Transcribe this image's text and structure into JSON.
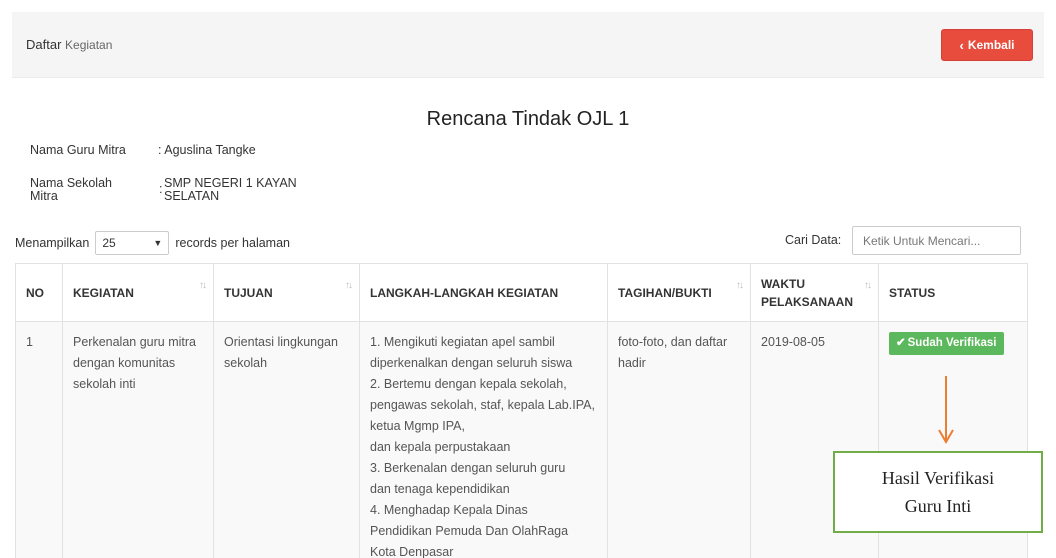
{
  "header": {
    "title": "Daftar",
    "subtitle": "Kegiatan",
    "back_label": "Kembali"
  },
  "page_heading": "Rencana Tindak OJL 1",
  "info": {
    "guru_label": "Nama Guru Mitra",
    "guru_value": ": Aguslina Tangke",
    "sekolah_label_1": "Nama Sekolah",
    "sekolah_label_2": "Mitra",
    "sekolah_value_1": "SMP NEGERI 1 KAYAN",
    "sekolah_value_2": "SELATAN",
    "sekolah_colon": ":"
  },
  "table_controls": {
    "show_label": "Menampilkan",
    "page_size": "25",
    "per_page_label": "records per halaman",
    "search_label": "Cari Data:",
    "search_placeholder": "Ketik Untuk Mencari..."
  },
  "table": {
    "columns": [
      "NO",
      "KEGIATAN",
      "TUJUAN",
      "LANGKAH-LANGKAH KEGIATAN",
      "TAGIHAN/BUKTI",
      "WAKTU PELAKSANAAN",
      "STATUS"
    ],
    "rows": [
      {
        "no": "1",
        "kegiatan": "Perkenalan guru mitra dengan komunitas sekolah inti",
        "tujuan": "Orientasi lingkungan sekolah",
        "langkah": [
          "1. Mengikuti kegiatan apel sambil",
          "diperkenalkan dengan seluruh siswa",
          "2. Bertemu dengan kepala sekolah,",
          "pengawas sekolah, staf, kepala Lab.IPA,",
          "ketua Mgmp IPA,",
          "dan kepala perpustakaan",
          "3. Berkenalan dengan seluruh guru",
          "dan tenaga kependidikan",
          "4. Menghadap Kepala Dinas",
          "Pendidikan Pemuda Dan OlahRaga",
          "Kota Denpasar"
        ],
        "tagihan": "foto-foto, dan daftar hadir",
        "waktu": "2019-08-05",
        "status": "Sudah Verifikasi"
      }
    ]
  },
  "callout": {
    "line1": "Hasil Verifikasi",
    "line2": "Guru Inti"
  },
  "colors": {
    "danger": "#e74c3c",
    "success": "#5cb85c",
    "arrow": "#ed7d31",
    "callout_border": "#70ad47"
  },
  "icons": {
    "back": "chevron-left-icon",
    "status": "check-icon",
    "sort": "sort-icon",
    "select": "caret-down-icon"
  }
}
